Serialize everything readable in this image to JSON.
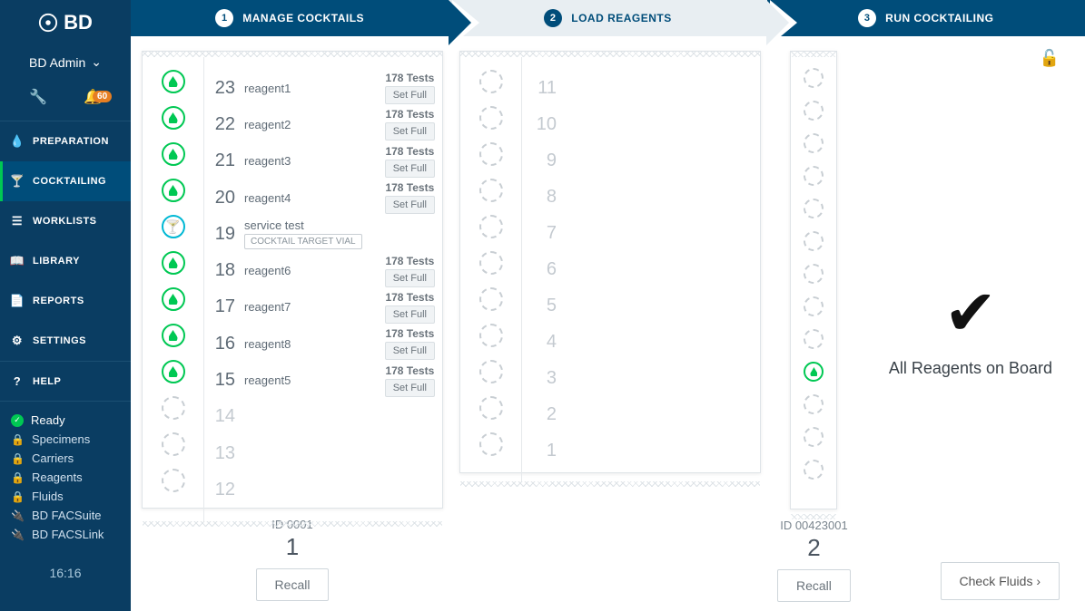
{
  "logo": "BD",
  "user": "BD Admin",
  "bell_count": "60",
  "nav": {
    "preparation": "PREPARATION",
    "cocktailing": "COCKTAILING",
    "worklists": "WORKLISTS",
    "library": "LIBRARY",
    "reports": "REPORTS",
    "settings": "SETTINGS",
    "help": "HELP"
  },
  "status": {
    "ready": "Ready",
    "specimens": "Specimens",
    "carriers": "Carriers",
    "reagents": "Reagents",
    "fluids": "Fluids",
    "facsuite": "BD FACSuite",
    "facslink": "BD FACSLink"
  },
  "clock": "16:16",
  "steps": {
    "s1": "MANAGE COCKTAILS",
    "s2": "LOAD REAGENTS",
    "s3": "RUN COCKTAILING",
    "n1": "1",
    "n2": "2",
    "n3": "3"
  },
  "rack1": {
    "id": "ID 0001",
    "num": "1",
    "recall": "Recall",
    "slots": [
      {
        "pos": "23",
        "name": "reagent1",
        "tests": "178 Tests",
        "set": "Set Full",
        "type": "full"
      },
      {
        "pos": "22",
        "name": "reagent2",
        "tests": "178 Tests",
        "set": "Set Full",
        "type": "full"
      },
      {
        "pos": "21",
        "name": "reagent3",
        "tests": "178 Tests",
        "set": "Set Full",
        "type": "full"
      },
      {
        "pos": "20",
        "name": "reagent4",
        "tests": "178 Tests",
        "set": "Set Full",
        "type": "full"
      },
      {
        "pos": "19",
        "name": "service test",
        "badge": "COCKTAIL TARGET VIAL",
        "type": "cocktail"
      },
      {
        "pos": "18",
        "name": "reagent6",
        "tests": "178 Tests",
        "set": "Set Full",
        "type": "full"
      },
      {
        "pos": "17",
        "name": "reagent7",
        "tests": "178 Tests",
        "set": "Set Full",
        "type": "full"
      },
      {
        "pos": "16",
        "name": "reagent8",
        "tests": "178 Tests",
        "set": "Set Full",
        "type": "full"
      },
      {
        "pos": "15",
        "name": "reagent5",
        "tests": "178 Tests",
        "set": "Set Full",
        "type": "full"
      },
      {
        "pos": "14",
        "type": "empty"
      },
      {
        "pos": "13",
        "type": "empty"
      },
      {
        "pos": "12",
        "type": "empty"
      }
    ]
  },
  "rack2": {
    "id": "ID 00423001",
    "num": "2",
    "recall": "Recall",
    "slots": [
      {
        "pos": "11"
      },
      {
        "pos": "10"
      },
      {
        "pos": "9"
      },
      {
        "pos": "8"
      },
      {
        "pos": "7"
      },
      {
        "pos": "6"
      },
      {
        "pos": "5"
      },
      {
        "pos": "4"
      },
      {
        "pos": "3"
      },
      {
        "pos": "2"
      },
      {
        "pos": "1"
      }
    ]
  },
  "rack3": {
    "slots": [
      "e",
      "e",
      "e",
      "e",
      "e",
      "e",
      "e",
      "e",
      "e",
      "full",
      "e",
      "e",
      "e"
    ]
  },
  "right": {
    "msg": "All Reagents on Board",
    "checkfluids": "Check Fluids ›"
  }
}
